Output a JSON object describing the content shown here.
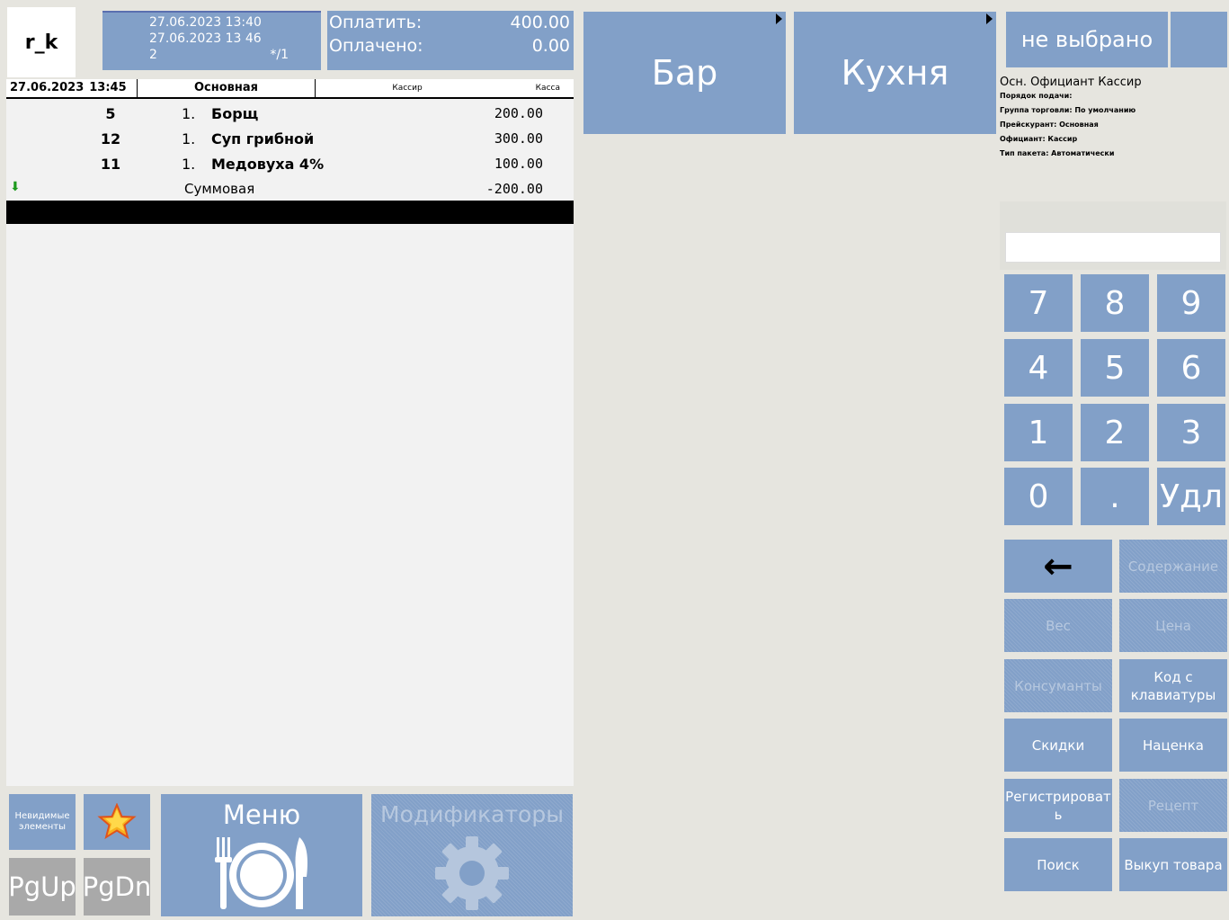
{
  "header": {
    "user": "r_k",
    "opened_at": "27.06.2023 13:40",
    "current_at": "27.06.2023 13 46",
    "guests": "2",
    "table": "*/1"
  },
  "payment": {
    "to_pay_label": "Оплатить:",
    "to_pay_value": "400.00",
    "paid_label": "Оплачено:",
    "paid_value": "0.00"
  },
  "order": {
    "header": {
      "date": "27.06.2023",
      "time": "13:45",
      "menu": "Основная",
      "waiter": "Кассир",
      "register": "Касса"
    },
    "items": [
      {
        "qty": "5",
        "course": "1.",
        "name": "Борщ",
        "price": "200.00"
      },
      {
        "qty": "12",
        "course": "1.",
        "name": "Суп грибной",
        "price": "300.00"
      },
      {
        "qty": "11",
        "course": "1.",
        "name": "Медовуха 4%",
        "price": "100.00"
      }
    ],
    "discount": {
      "name": "Суммовая",
      "value": "-200.00"
    }
  },
  "bottom_buttons": {
    "invisible": "Невидимые элементы",
    "pgup": "PgUp",
    "pgdn": "PgDn",
    "menu": "Меню",
    "modifiers": "Модификаторы"
  },
  "categories": [
    {
      "label": "Бар"
    },
    {
      "label": "Кухня"
    }
  ],
  "right": {
    "waiter_select": "не выбрано",
    "info_line": "Осн. Официант  Кассир",
    "info": [
      "Порядок подачи:",
      "Группа торговли: По умолчанию",
      "Прейскурант: Основная",
      "Официант: Кассир",
      "Тип пакета: Автоматически"
    ]
  },
  "keypad": [
    "7",
    "8",
    "9",
    "4",
    "5",
    "6",
    "1",
    "2",
    "3",
    "0",
    ".",
    "Удл"
  ],
  "functions": {
    "backspace": "←",
    "content": "Содержание",
    "weight": "Вес",
    "price": "Цена",
    "consumants": "Консуманты",
    "kbd_code": "Код с клавиатуры",
    "discounts": "Скидки",
    "markup": "Наценка",
    "register": "Регистрироват ь",
    "recipe": "Рецепт",
    "search": "Поиск",
    "buyout": "Выкуп товара"
  },
  "colors": {
    "button_blue": "#82a0c8",
    "button_gray": "#a9a9a9",
    "background": "#e6e5df"
  }
}
